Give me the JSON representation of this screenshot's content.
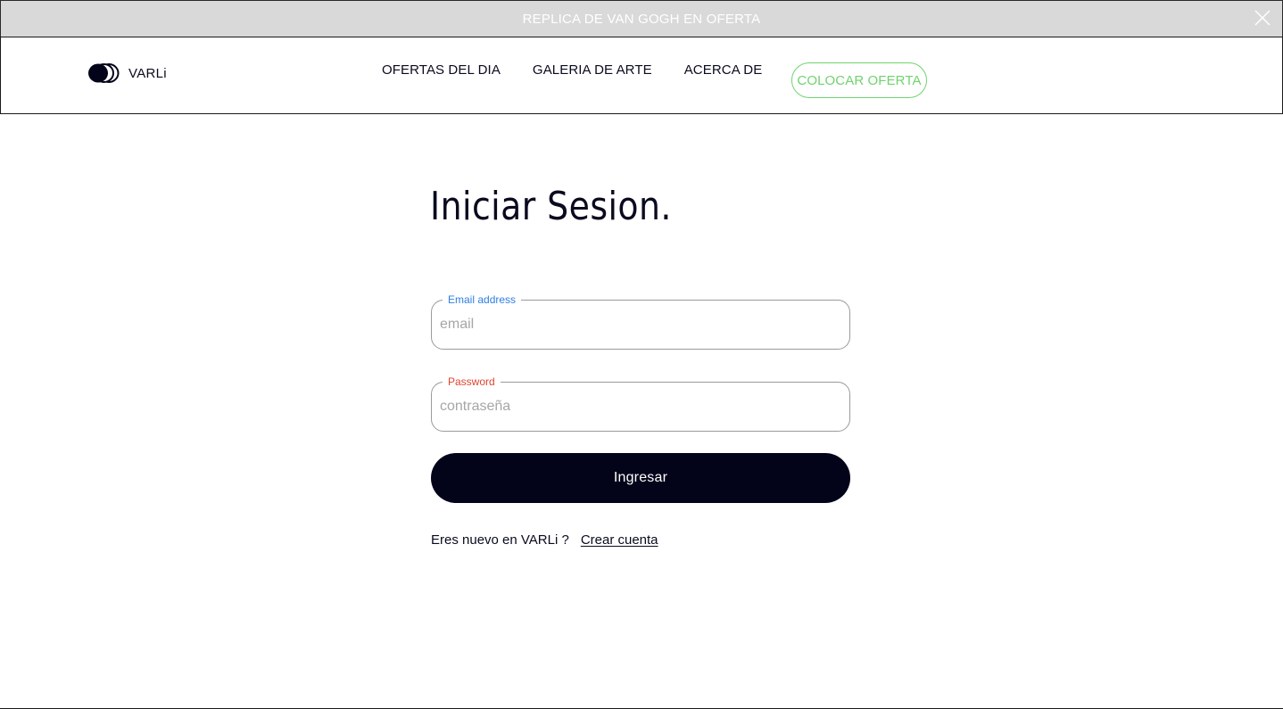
{
  "promo_bar": {
    "text": "REPLICA DE VAN GOGH EN OFERTA",
    "close_icon": "close-icon"
  },
  "header": {
    "brand_name": "VARLi",
    "logo_icon": "varli-logo-icon",
    "nav": {
      "deals": "OFERTAS DEL DIA",
      "gallery": "GALERIA DE ARTE",
      "about": "ACERCA DE"
    },
    "cta_label": "COLOCAR OFERTA"
  },
  "login": {
    "title": "Iniciar Sesion.",
    "email": {
      "label": "Email address",
      "placeholder": "email",
      "value": ""
    },
    "password": {
      "label": "Password",
      "placeholder": "contraseña",
      "value": ""
    },
    "submit_label": "Ingresar",
    "signup_prompt": "Eres nuevo en VARLi ?",
    "signup_link": "Crear cuenta"
  },
  "colors": {
    "dark_navy": "#03031a",
    "cta_green": "#6fd36f",
    "promo_gray": "#d9d9d9",
    "email_label_blue": "#2f7fe0",
    "password_label_red": "#e0452f"
  }
}
